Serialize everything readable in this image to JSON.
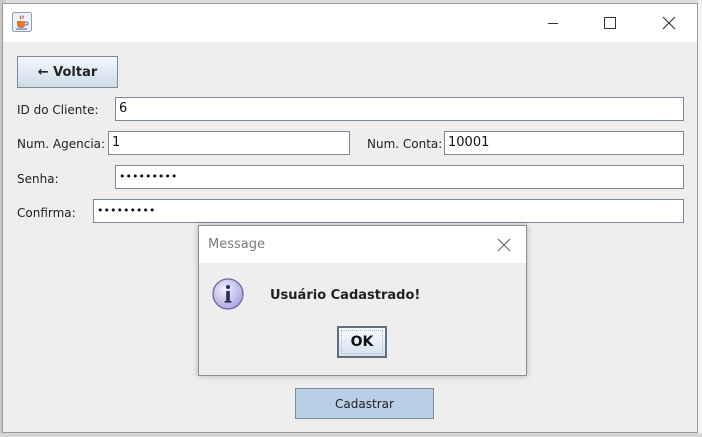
{
  "window": {
    "title": "",
    "icon": "java-cup-icon",
    "controls": [
      "minimize-icon",
      "maximize-icon",
      "close-icon"
    ]
  },
  "form": {
    "back_button": "← Voltar",
    "id_cliente_label": "ID do Cliente:",
    "id_cliente_value": "6",
    "num_agencia_label": "Num. Agencia:",
    "num_agencia_value": "1",
    "num_conta_label": "Num. Conta:",
    "num_conta_value": "10001",
    "senha_label": "Senha:",
    "senha_value": "•••••••••",
    "confirma_label": "Confirma:",
    "confirma_value": "•••••••••",
    "submit_button": "Cadastrar"
  },
  "dialog": {
    "title": "Message",
    "icon": "info-icon",
    "message": "Usuário Cadastrado!",
    "ok_button": "OK"
  },
  "colors": {
    "submit_button_bg": "#b8cfe5",
    "window_bg": "#eeeeee",
    "info_icon_fill": "#b9b5e6"
  }
}
